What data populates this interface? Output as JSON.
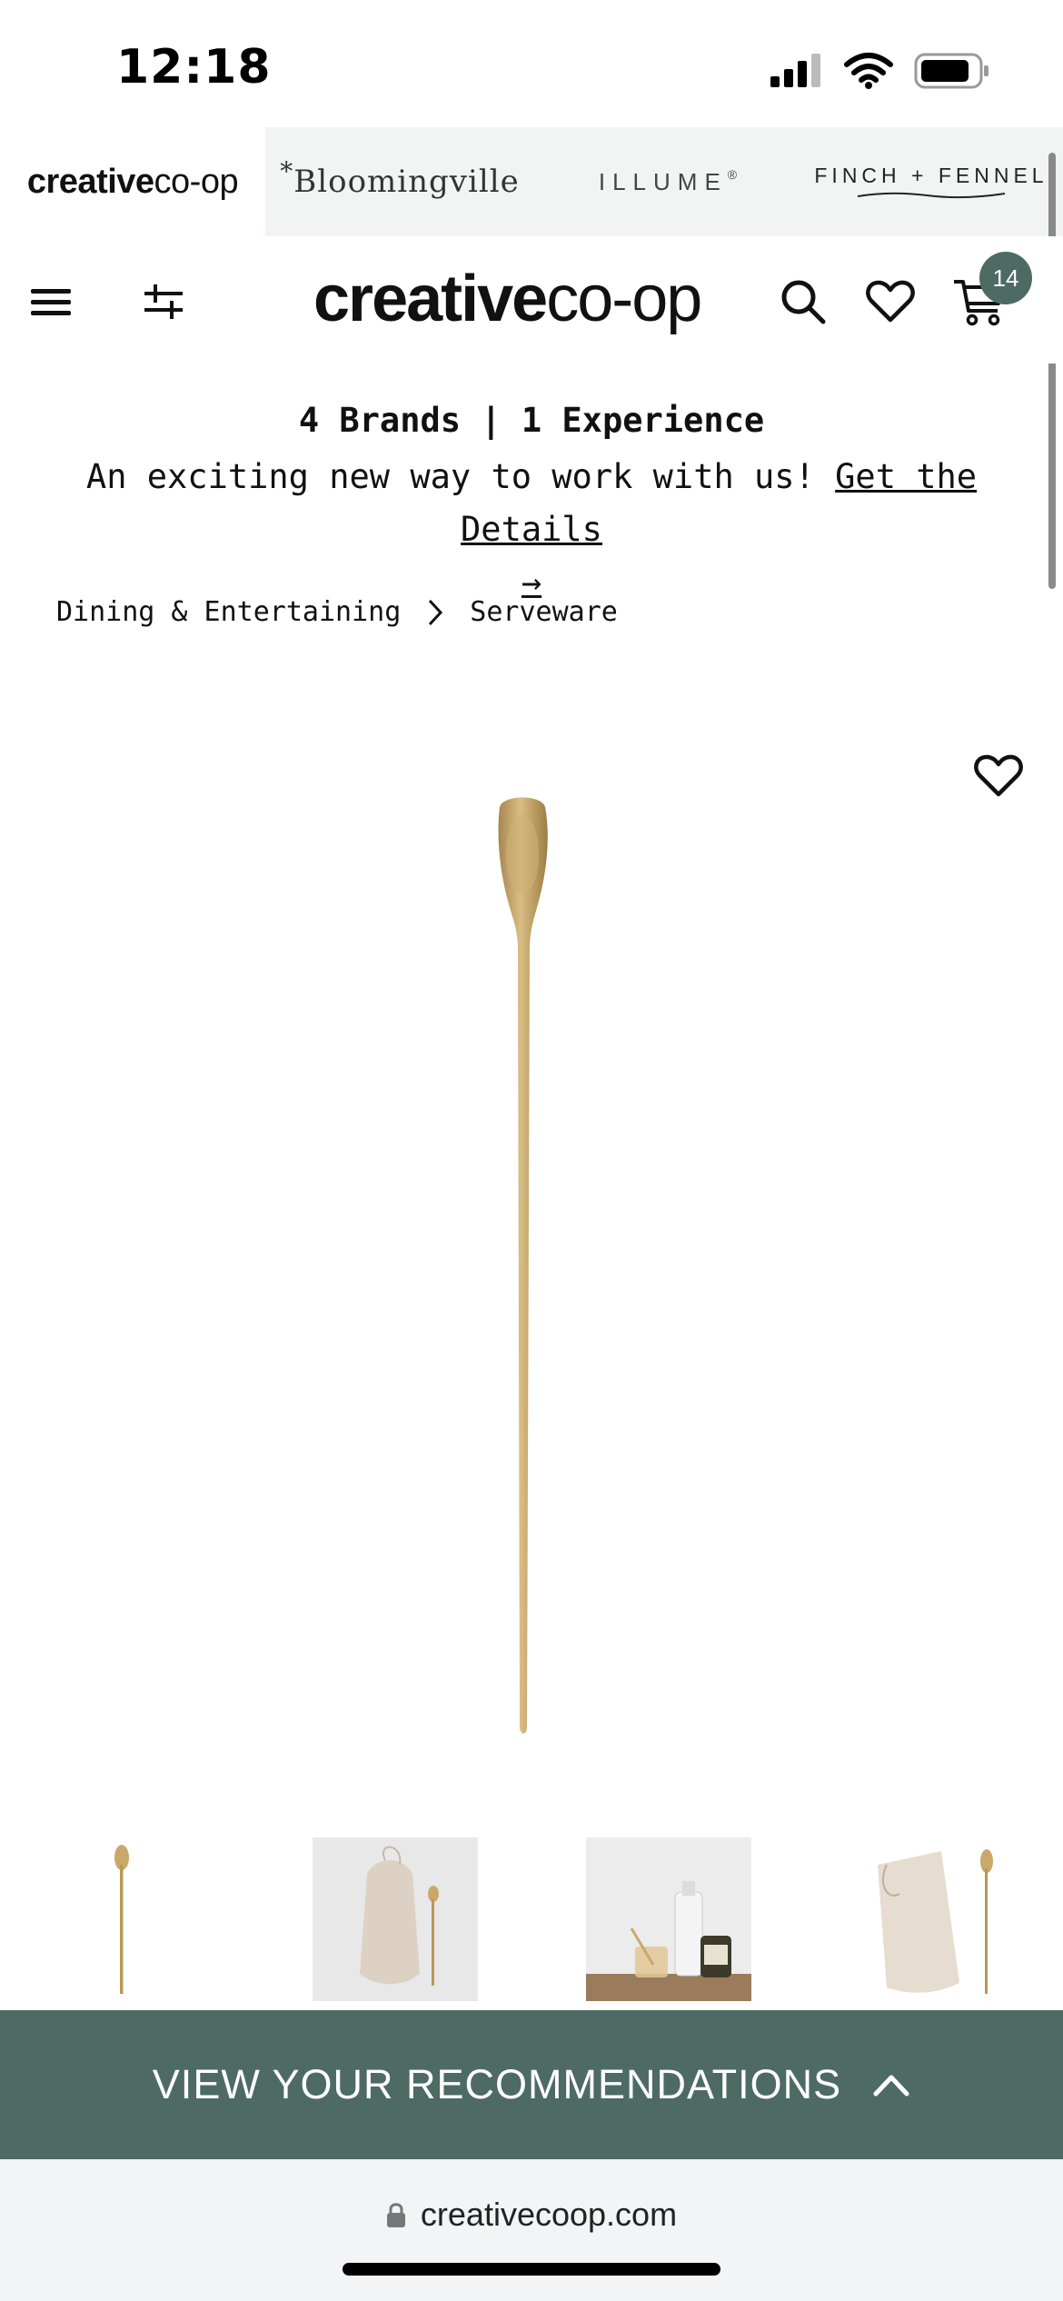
{
  "status_bar": {
    "time": "12:18"
  },
  "brand_bar": {
    "brands": [
      {
        "bold": "creative",
        "rest": "co-op",
        "active": true
      },
      {
        "label": "Bloomingville",
        "prefix": "*"
      },
      {
        "label": "ILLUME",
        "suffix": "®"
      },
      {
        "label": "FINCH + FENNEL"
      }
    ]
  },
  "header": {
    "logo_bold": "creative",
    "logo_rest": "co-op",
    "cart_count": "14",
    "icons": [
      "menu-icon",
      "filter-icon",
      "search-icon",
      "heart-icon",
      "cart-icon"
    ]
  },
  "promo": {
    "title": "4 Brands | 1 Experience",
    "body": "An exciting new way to work with us! ",
    "link": "Get the Details",
    "arrow": "→"
  },
  "breadcrumb": {
    "items": [
      "Dining & Entertaining",
      "Serveware"
    ]
  },
  "product": {
    "image": "brass-spoon",
    "thumbnails": [
      "spoon",
      "spoon-with-cotton-bag",
      "spoon-with-bottles-and-jar",
      "cotton-bag-and-spoon"
    ]
  },
  "recommendations": {
    "label": "VIEW YOUR RECOMMENDATIONS"
  },
  "url_bar": {
    "url": "creativecoop.com"
  },
  "colors": {
    "accent": "#4d6b63",
    "brand_bar_bg": "#f2f4f4",
    "brass": "#c9a86a"
  }
}
